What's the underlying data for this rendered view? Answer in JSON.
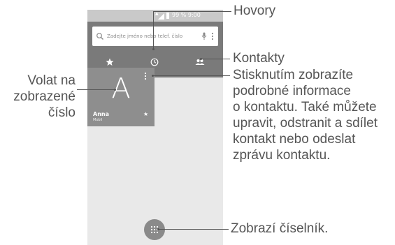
{
  "phone": {
    "status_text": "99 % 9:00",
    "search_placeholder": "Zadejte jméno nebo telef. číslo",
    "tabs": [
      {
        "icon": "star-icon",
        "selected": true
      },
      {
        "icon": "clock-icon",
        "selected": false
      },
      {
        "icon": "contacts-icon",
        "selected": false
      }
    ],
    "contact": {
      "initial": "A",
      "name": "Anna",
      "type": "Mobil",
      "starred": true
    },
    "dialpad_icon": "dialpad-icon"
  },
  "callouts": {
    "hovory": "Hovory",
    "kontakty": "Kontakty",
    "detail": [
      "Stisknutím zobrazíte",
      "podrobné informace",
      "o kontaktu. Také můžete",
      "upravit, odstranit a sdílet",
      "kontakt nebo odeslat",
      "zprávu kontaktu."
    ],
    "call_number": [
      "Volat na",
      "zobrazené",
      "číslo"
    ],
    "dialpad": "Zobrazí číselník."
  },
  "colors": {
    "header": "#7a7a7a",
    "card": "#8e8e8e",
    "background": "#e9e9e9",
    "text": "#555555"
  }
}
